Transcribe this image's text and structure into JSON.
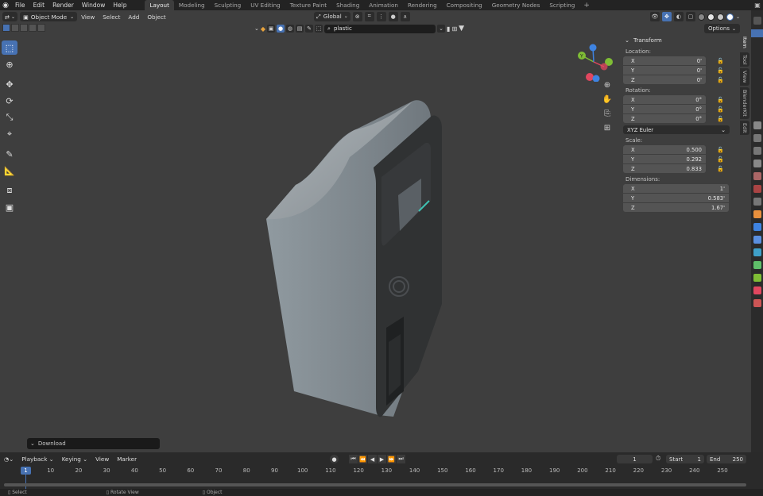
{
  "app_icon": "blender-logo-icon",
  "menubar": {
    "items": [
      "File",
      "Edit",
      "Render",
      "Window",
      "Help"
    ]
  },
  "workspaces": [
    "Layout",
    "Modeling",
    "Sculpting",
    "UV Editing",
    "Texture Paint",
    "Shading",
    "Animation",
    "Rendering",
    "Compositing",
    "Geometry Nodes",
    "Scripting"
  ],
  "active_workspace": "Layout",
  "viewport_header": {
    "mode": "Object Mode",
    "menus": [
      "View",
      "Select",
      "Add",
      "Object"
    ],
    "transform_orientation": "Global",
    "options_label": "Options"
  },
  "search": {
    "value": "plastic"
  },
  "n_panel": {
    "title": "Transform",
    "location": {
      "label": "Location:",
      "rows": [
        {
          "axis": "X",
          "value": "0'"
        },
        {
          "axis": "Y",
          "value": "0'"
        },
        {
          "axis": "Z",
          "value": "0'"
        }
      ]
    },
    "rotation": {
      "label": "Rotation:",
      "rows": [
        {
          "axis": "X",
          "value": "0°"
        },
        {
          "axis": "Y",
          "value": "0°"
        },
        {
          "axis": "Z",
          "value": "0°"
        }
      ],
      "mode": "XYZ Euler"
    },
    "scale": {
      "label": "Scale:",
      "rows": [
        {
          "axis": "X",
          "value": "0.500"
        },
        {
          "axis": "Y",
          "value": "0.292"
        },
        {
          "axis": "Z",
          "value": "0.833"
        }
      ]
    },
    "dimensions": {
      "label": "Dimensions:",
      "rows": [
        {
          "axis": "X",
          "value": "1'"
        },
        {
          "axis": "Y",
          "value": "0.583'"
        },
        {
          "axis": "Z",
          "value": "1.67'"
        }
      ]
    }
  },
  "side_tabs": [
    "Item",
    "Tool",
    "View",
    "BlenderKit",
    "Edit"
  ],
  "active_side_tab": "Item",
  "download_panel": {
    "label": "Download"
  },
  "timeline": {
    "menus": [
      "Playback",
      "Keying",
      "View",
      "Marker"
    ],
    "current_frame": "1",
    "start_label": "Start",
    "start_value": "1",
    "end_label": "End",
    "end_value": "250",
    "ruler": [
      "1",
      "10",
      "20",
      "30",
      "40",
      "50",
      "60",
      "70",
      "80",
      "90",
      "100",
      "110",
      "120",
      "130",
      "140",
      "150",
      "160",
      "170",
      "180",
      "190",
      "200",
      "210",
      "220",
      "230",
      "240",
      "250"
    ]
  },
  "statusbar": {
    "items": [
      "Select",
      "Rotate View",
      "Object"
    ]
  },
  "colors": {
    "accent": "#4772b3",
    "viewport_bg": "#3e3e3e",
    "axis_x": "#e1475f",
    "axis_y": "#7fbd35",
    "axis_z": "#3e83e1",
    "screen_glow": "#3fc3b4"
  }
}
